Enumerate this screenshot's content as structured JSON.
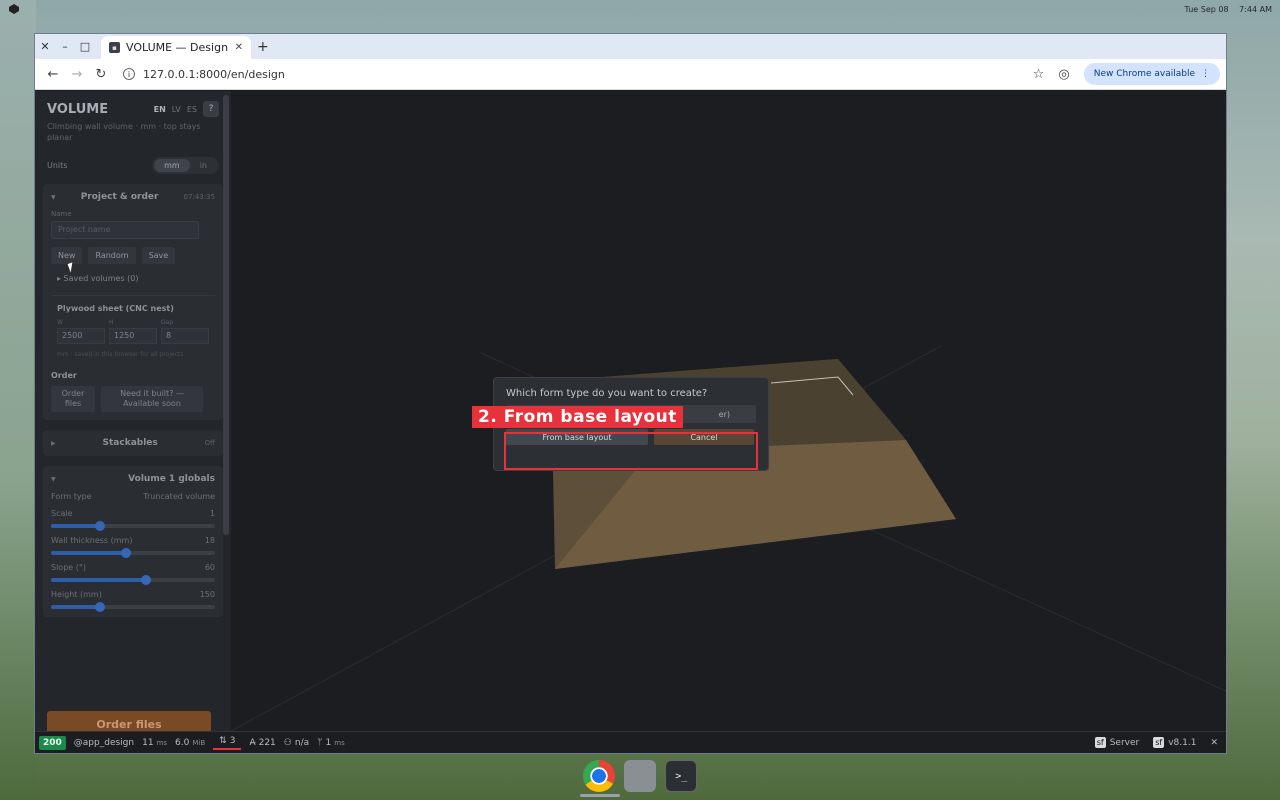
{
  "system": {
    "date": "Tue Sep 08",
    "time": "7:44 AM"
  },
  "browser": {
    "tab_title": "VOLUME — Design",
    "url": "127.0.0.1:8000/en/design",
    "update_label": "New Chrome available"
  },
  "sidebar": {
    "brand": "VOLUME",
    "langs": [
      "EN",
      "LV",
      "ES"
    ],
    "help": "?",
    "subtitle": "Climbing wall volume · mm · top stays planar",
    "units_label": "Units",
    "units": [
      "mm",
      "in"
    ],
    "project": {
      "title": "Project & order",
      "time": "07:43:35",
      "name_label": "Name",
      "name_placeholder": "Project name",
      "new_btn": "New",
      "random_btn": "Random",
      "save_btn": "Save",
      "saved": "▸ Saved volumes (0)"
    },
    "plywood": {
      "title": "Plywood sheet (CNC nest)",
      "w_label": "W",
      "h_label": "H",
      "gap_label": "Gap",
      "w": "2500",
      "h": "1250",
      "gap": "8",
      "note": "mm · saved in this browser for all projects"
    },
    "order": {
      "title": "Order",
      "order_files_btn": "Order files",
      "built_btn": "Need it built? — Available soon"
    },
    "stackables": {
      "title": "Stackables",
      "state": "Off"
    },
    "globals": {
      "title": "Volume 1 globals",
      "form_type_label": "Form type",
      "form_type_value": "Truncated volume",
      "sliders": [
        {
          "label": "Scale",
          "value": "1",
          "pos": 0.3
        },
        {
          "label": "Wall thickness (mm)",
          "value": "18",
          "pos": 0.46
        },
        {
          "label": "Slope (°)",
          "value": "60",
          "pos": 0.58
        },
        {
          "label": "Height (mm)",
          "value": "150",
          "pos": 0.3
        }
      ]
    },
    "order_files_cta": "Order files"
  },
  "dialog": {
    "question": "Which form type do you want to create?",
    "option_partial": "er)",
    "from_base_btn": "From base layout",
    "cancel_btn": "Cancel"
  },
  "annotation": {
    "label": "2. From base layout"
  },
  "statusbar": {
    "code": "200",
    "route": "@app_design",
    "time": "11",
    "time_unit": "ms",
    "memory": "6.0",
    "memory_unit": "MiB",
    "requests": "3",
    "translations": "221",
    "user": "n/a",
    "events": "1",
    "events_unit": "ms",
    "server": "Server",
    "version": "v8.1.1"
  },
  "colors": {
    "accent_red": "#e8313a",
    "status_green": "#1a8b4b",
    "slider_blue": "#3567b8",
    "box_tan": "#7a6445"
  }
}
